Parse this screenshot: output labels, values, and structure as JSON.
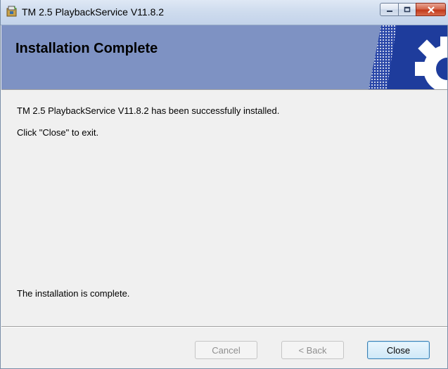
{
  "window": {
    "title": "TM 2.5 PlaybackService V11.8.2",
    "icons": {
      "app": "installer-icon",
      "minimize": "minimize-icon",
      "maximize": "maximize-icon",
      "close": "close-icon"
    }
  },
  "banner": {
    "title": "Installation Complete",
    "graphic": "gear-graphic",
    "color": "#7e92c3"
  },
  "content": {
    "message": "TM 2.5 PlaybackService V11.8.2 has been successfully installed.",
    "instruction": "Click \"Close\" to exit.",
    "status": "The installation is complete."
  },
  "buttons": {
    "cancel": "Cancel",
    "back": "< Back",
    "close": "Close"
  }
}
